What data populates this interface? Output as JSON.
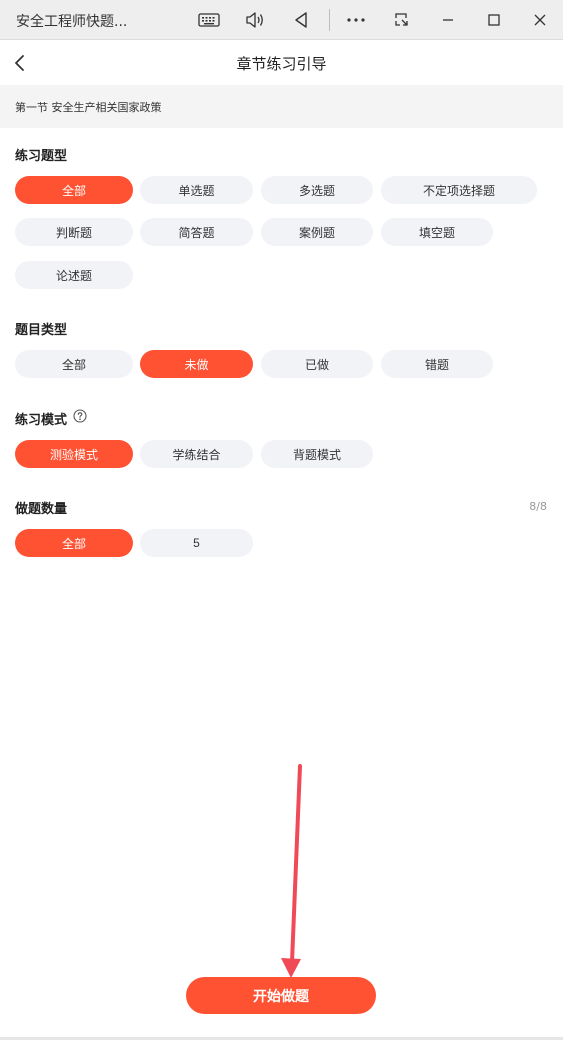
{
  "window": {
    "title": "安全工程师快题..."
  },
  "nav": {
    "title": "章节练习引导"
  },
  "chapter": {
    "label": "第一节 安全生产相关国家政策"
  },
  "practice_type": {
    "title": "练习题型",
    "options": [
      "全部",
      "单选题",
      "多选题",
      "不定项选择题",
      "判断题",
      "简答题",
      "案例题",
      "填空题",
      "论述题"
    ],
    "selected": "全部"
  },
  "question_status": {
    "title": "题目类型",
    "options": [
      "全部",
      "未做",
      "已做",
      "错题"
    ],
    "selected": "未做"
  },
  "practice_mode": {
    "title": "练习模式",
    "options": [
      "测验模式",
      "学练结合",
      "背题模式"
    ],
    "selected": "测验模式"
  },
  "question_count": {
    "title": "做题数量",
    "count": "8/8",
    "options": [
      "全部",
      "5"
    ],
    "selected": "全部"
  },
  "start_button": {
    "label": "开始做题"
  },
  "colors": {
    "accent": "#ff5233",
    "pill_bg": "#f2f3f7",
    "annotation_arrow": "#f04a57"
  }
}
